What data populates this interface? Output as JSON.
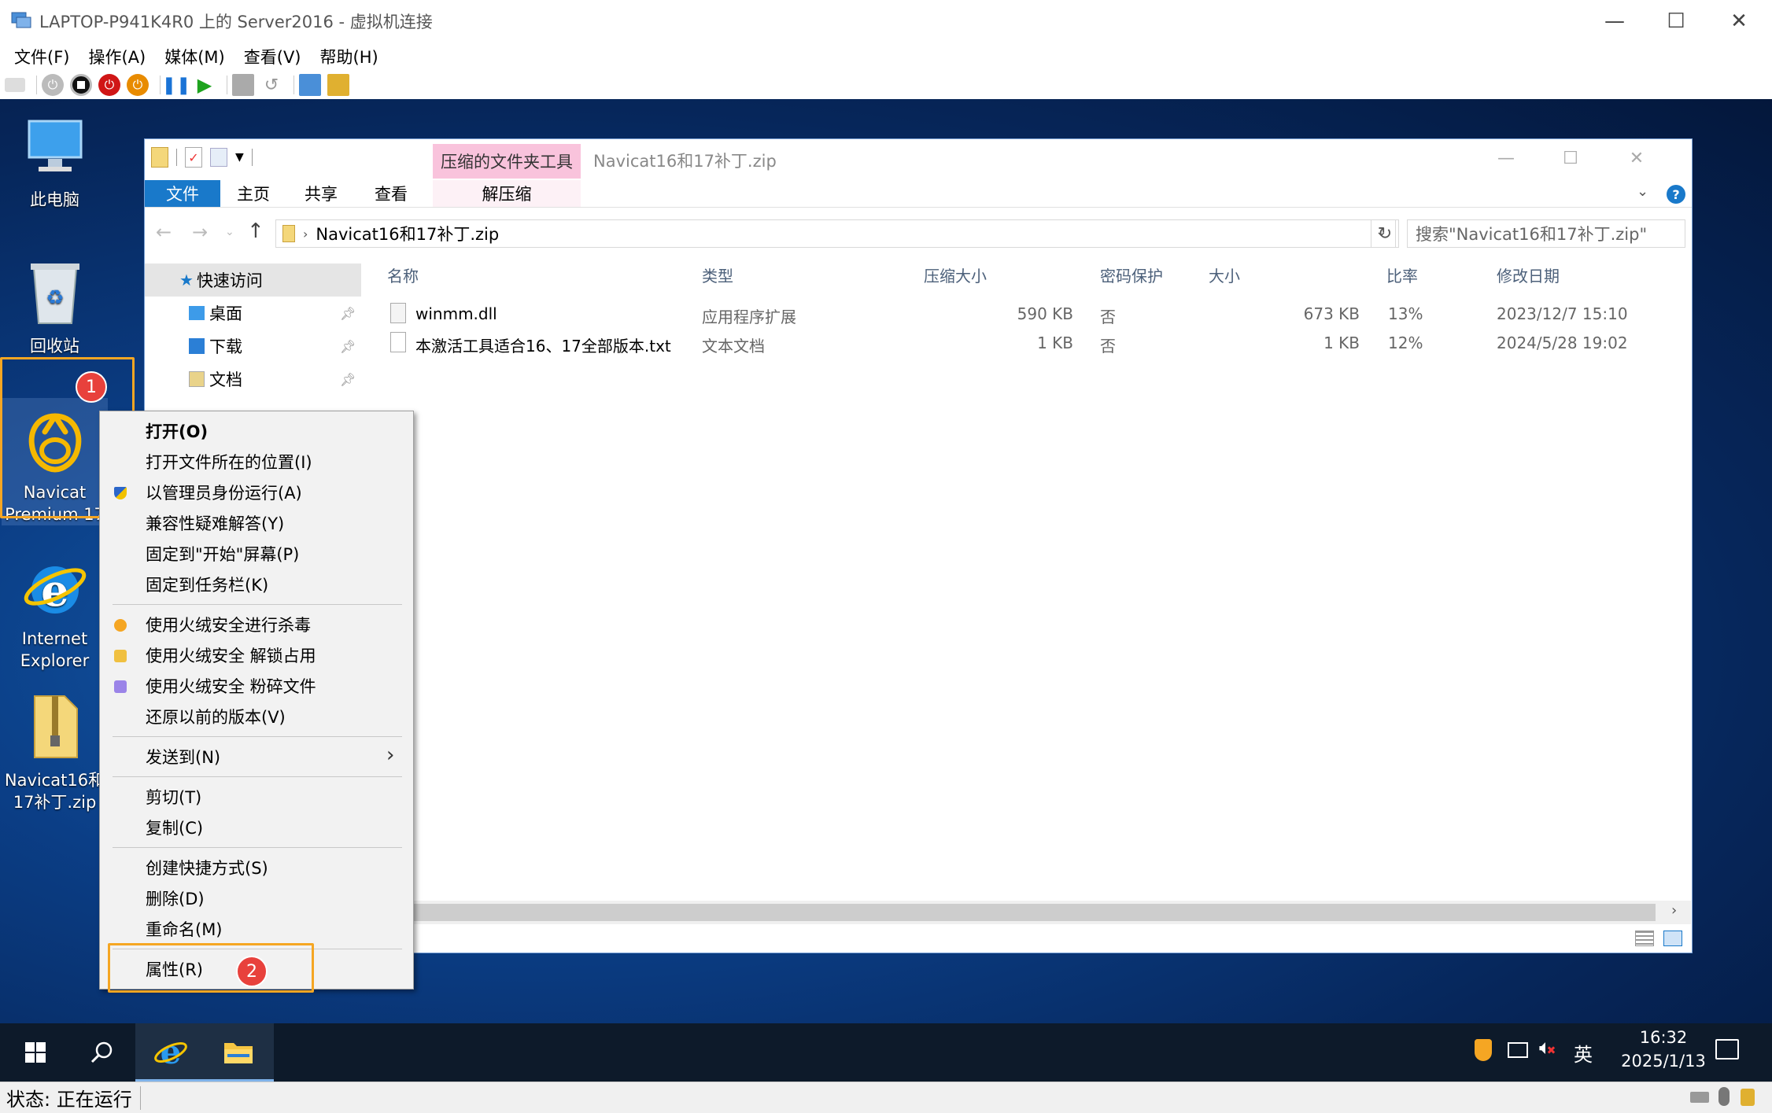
{
  "vm": {
    "title": "LAPTOP-P941K4R0 上的 Server2016 - 虚拟机连接",
    "menu": [
      "文件(F)",
      "操作(A)",
      "媒体(M)",
      "查看(V)",
      "帮助(H)"
    ],
    "status": "状态: 正在运行"
  },
  "desktop": {
    "icons": [
      {
        "label": "此电脑",
        "icon": "this-pc-icon"
      },
      {
        "label": "回收站",
        "icon": "recycle-bin-icon"
      },
      {
        "label": "Navicat Premium 17",
        "icon": "navicat-icon"
      },
      {
        "label": "Internet Explorer",
        "icon": "ie-icon"
      },
      {
        "label": "Navicat16和17补丁.zip",
        "icon": "zip-folder-icon"
      }
    ]
  },
  "explorer": {
    "tool_tab": "压缩的文件夹工具",
    "title": "Navicat16和17补丁.zip",
    "ribbon_tabs": [
      "文件",
      "主页",
      "共享",
      "查看",
      "解压缩"
    ],
    "address": "Navicat16和17补丁.zip",
    "search_placeholder": "搜索\"Navicat16和17补丁.zip\"",
    "nav": {
      "quick_access": "快速访问",
      "items": [
        "桌面",
        "下载",
        "文档"
      ]
    },
    "columns": [
      "名称",
      "类型",
      "压缩大小",
      "密码保护",
      "大小",
      "比率",
      "修改日期"
    ],
    "rows": [
      {
        "name": "winmm.dll",
        "type": "应用程序扩展",
        "packed": "590 KB",
        "pwd": "否",
        "size": "673 KB",
        "ratio": "13%",
        "date": "2023/12/7 15:10"
      },
      {
        "name": "本激活工具适合16、17全部版本.txt",
        "type": "文本文档",
        "packed": "1 KB",
        "pwd": "否",
        "size": "1 KB",
        "ratio": "12%",
        "date": "2024/5/28 19:02"
      }
    ]
  },
  "context_menu": {
    "items": [
      "打开(O)",
      "打开文件所在的位置(I)",
      "以管理员身份运行(A)",
      "兼容性疑难解答(Y)",
      "固定到\"开始\"屏幕(P)",
      "固定到任务栏(K)",
      "使用火绒安全进行杀毒",
      "使用火绒安全 解锁占用",
      "使用火绒安全 粉碎文件",
      "还原以前的版本(V)",
      "发送到(N)",
      "剪切(T)",
      "复制(C)",
      "创建快捷方式(S)",
      "删除(D)",
      "重命名(M)",
      "属性(R)"
    ]
  },
  "badges": [
    "1",
    "2"
  ],
  "taskbar": {
    "time": "16:32",
    "date": "2025/1/13",
    "ime": "英"
  },
  "colors": {
    "accent": "#1979ca",
    "highlight": "#f5a623",
    "badge": "#e8413c"
  }
}
